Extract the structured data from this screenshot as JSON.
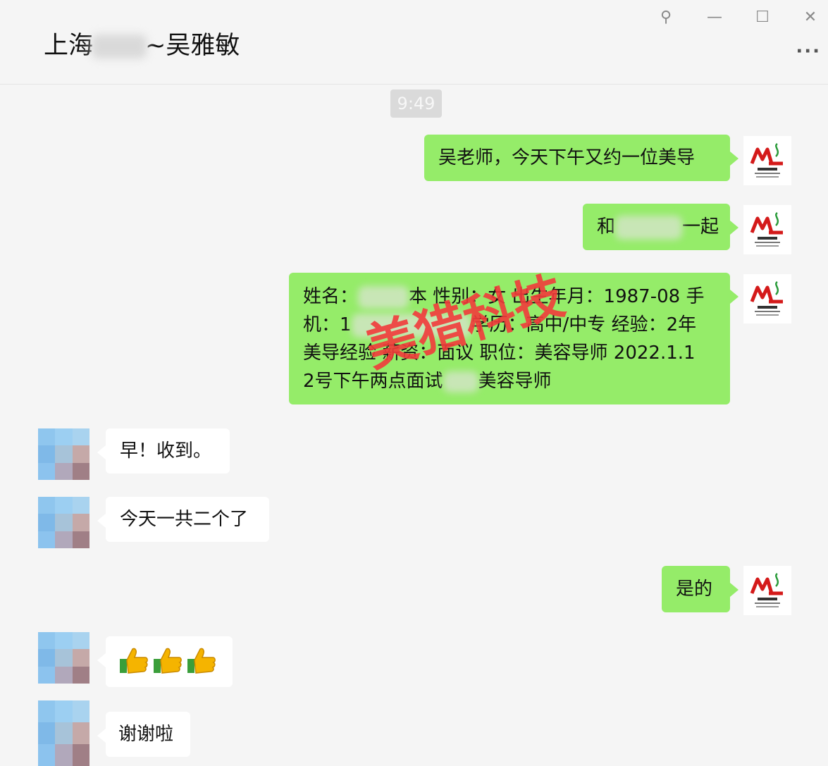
{
  "header": {
    "title_prefix": "上海",
    "title_suffix": "~吴雅敏",
    "icons": [
      "pin-icon",
      "minimize-icon",
      "maximize-icon",
      "close-icon",
      "more-icon"
    ],
    "pin": "⚲",
    "minimize": "—",
    "maximize": "☐",
    "close": "✕",
    "more": "···"
  },
  "chat": {
    "timestamp": "9:49",
    "messages": [
      {
        "from": "me",
        "text": "吴老师，今天下午又约一位美导"
      },
      {
        "from": "me",
        "text_prefix": "和",
        "text_suffix": "一起"
      },
      {
        "from": "me",
        "lines": [
          "姓名：",
          "本 性别：女 出生年月：1987-08 手",
          "机：1",
          "学历：高中/中专 经验：2年",
          "美导经验 薪资：面议 职位：美容导师 2022.1.1",
          "2号下午两点面试",
          "美容导师"
        ]
      },
      {
        "from": "them",
        "text": "早！收到。"
      },
      {
        "from": "them",
        "text": "今天一共二个了"
      },
      {
        "from": "me",
        "text": "是的"
      },
      {
        "from": "them",
        "emoji": "👍👍👍"
      },
      {
        "from": "them",
        "text": "谢谢啦"
      }
    ]
  },
  "watermark": "美猎科技",
  "colors": {
    "my_bubble": "#95ec69",
    "their_bubble": "#ffffff",
    "background": "#f5f5f5",
    "watermark": "#f23b3b"
  }
}
